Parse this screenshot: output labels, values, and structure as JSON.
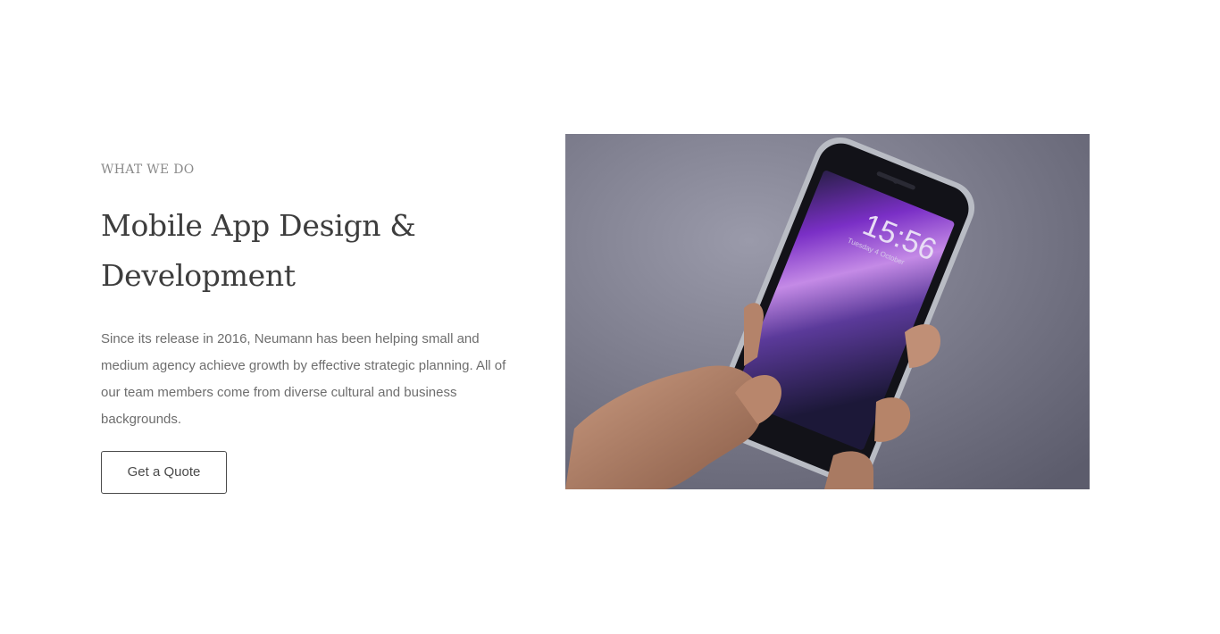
{
  "section": {
    "eyebrow": "WHAT WE DO",
    "title": "Mobile App Design & Development",
    "body": "Since its release in 2016, Neumann has been helping small and medium agency achieve growth by effective strategic planning. All of our team members come from diverse cultural and business backgrounds.",
    "cta_label": "Get a Quote"
  },
  "photo": {
    "alt": "Hand holding a smartphone showing a purple lock screen",
    "lock_time": "15:56",
    "lock_date": "Tuesday 4 October"
  },
  "colors": {
    "eyebrow": "#8a8a8a",
    "title": "#3d3d3d",
    "body": "#6e6e6e",
    "cta_border": "#4a4a4a",
    "photo_background": "#767686",
    "screen_accent": "#9b4fd6"
  }
}
